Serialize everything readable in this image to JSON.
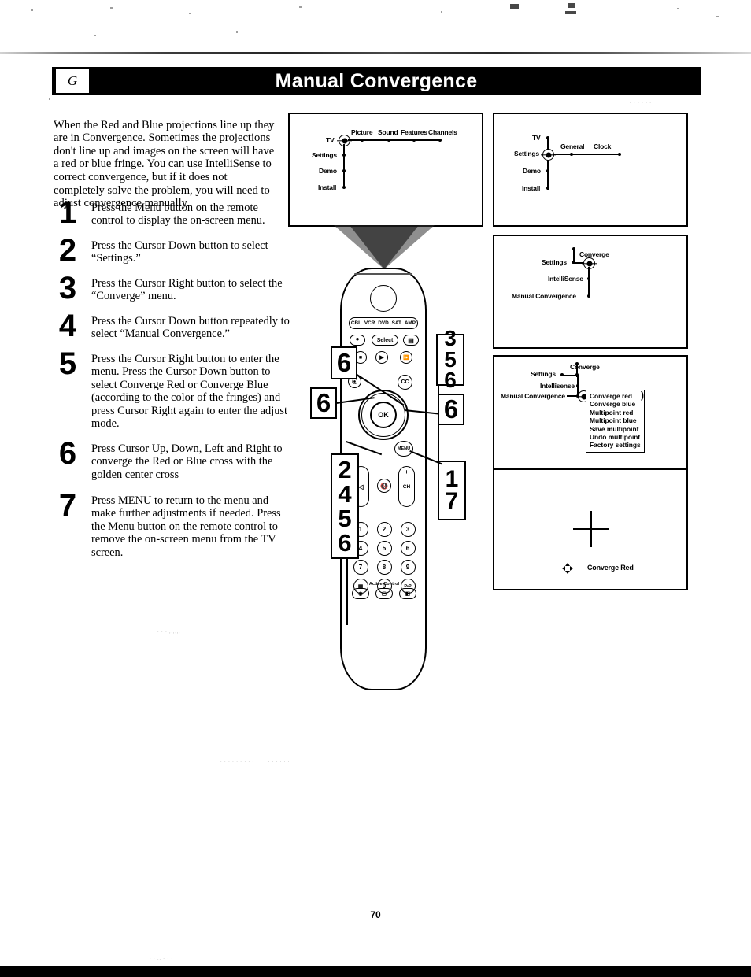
{
  "header": {
    "tab_letter": "G",
    "title": "Manual Convergence"
  },
  "intro": "When the Red and Blue projections line up they are in Convergence.  Sometimes the projections don't line up and images on the screen will have a red or blue fringe.  You can use IntelliSense to correct convergence, but if it does not completely solve the problem, you will need to adjust convergence manually.",
  "steps": [
    {
      "num": "1",
      "text": "Press the Menu button on the remote control to display the on-screen menu."
    },
    {
      "num": "2",
      "text": "Press the Cursor Down button to select “Settings.”"
    },
    {
      "num": "3",
      "text": "Press the Cursor Right button to select the “Converge” menu."
    },
    {
      "num": "4",
      "text": "Press the Cursor Down button repeatedly to select “Manual Convergence.”"
    },
    {
      "num": "5",
      "text": "Press the Cursor Right button to enter the menu.  Press the Cursor Down button to select Converge Red or Converge Blue (according to the color of the fringes) and press Cursor Right again to enter the adjust mode."
    },
    {
      "num": "6",
      "text": "Press Cursor Up, Down, Left and Right to converge the Red or Blue cross with the golden center cross"
    },
    {
      "num": "7",
      "text": "Press MENU to return to the menu and make further adjustments if needed. Press the Menu button on the remote control to remove the on-screen menu from the TV screen."
    }
  ],
  "panels": {
    "panel1": {
      "root_label": "TV",
      "vertical_items": [
        "Settings",
        "Demo",
        "Install"
      ],
      "horizontal_items": [
        "Picture",
        "Sound",
        "Features",
        "Channels"
      ],
      "selected": "TV"
    },
    "panel2": {
      "root_label": "TV",
      "vertical_items": [
        "Settings",
        "Demo",
        "Install"
      ],
      "horizontal_items": [
        "General",
        "Clock"
      ],
      "selected": "Settings"
    },
    "panel3": {
      "parent": "Settings",
      "branch_label": "Converge",
      "children": [
        "IntelliSense",
        "Manual Convergence"
      ],
      "selected": "Converge"
    },
    "panel4": {
      "parent": "Settings",
      "branch_label": "Converge",
      "children": [
        "Intellisense",
        "Manual Convergence"
      ],
      "selected": "Manual Convergence",
      "list_items": [
        "Converge red",
        "Converge blue",
        "Multipoint red",
        "Multipoint blue",
        "Save multipoint",
        "Undo multipoint",
        "Factory settings"
      ]
    },
    "panel5": {
      "caption": "Converge Red",
      "cursor_icon": "four-way-arrow-icon"
    }
  },
  "remote": {
    "power_icon": "power-icon",
    "device_buttons": [
      "CBL",
      "VCR",
      "DVD",
      "SAT",
      "AMP"
    ],
    "select_label": "Select",
    "ok_label": "OK",
    "menu_label": "MENU",
    "cc_label": "CC",
    "mute_icon": "mute-icon",
    "volume_plus": "+",
    "volume_minus": "–",
    "volume_icon": "volume-icon",
    "channel_label": "CH",
    "channel_plus": "+",
    "channel_minus": "–",
    "keypad": [
      "1",
      "2",
      "3",
      "4",
      "5",
      "6",
      "7",
      "8",
      "9"
    ],
    "key_zero": "0",
    "key_list": "list-icon",
    "key_pip": "P•P",
    "active_control_label": "Active Control",
    "bottom_buttons": [
      "surround-icon",
      "screen-icon",
      "picture-icon"
    ],
    "transport": [
      "stop-icon",
      "play-icon",
      "ff-icon",
      "rec-icon"
    ]
  },
  "callouts": {
    "right_upper": [
      "3",
      "5",
      "6"
    ],
    "right_lower": [
      "1",
      "7"
    ],
    "left_stack": [
      "2",
      "4",
      "5",
      "6"
    ],
    "left_single": "6",
    "left_mid": "6",
    "right_mid": "6"
  },
  "footer": {
    "page_number": "70"
  }
}
